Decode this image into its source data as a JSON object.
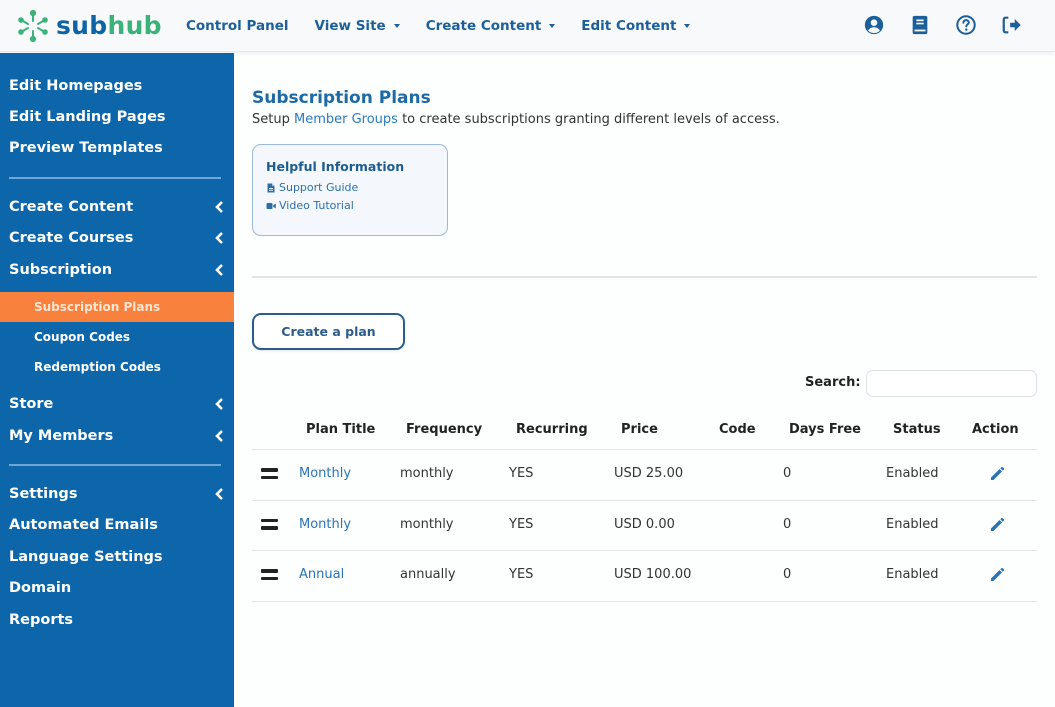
{
  "brand": {
    "name_part1": "sub",
    "name_part2": "hub",
    "colors": {
      "primary": "#0d66aa",
      "accent": "#3bb27a",
      "active": "#f7813d"
    }
  },
  "topnav": {
    "items": [
      {
        "label": "Control Panel",
        "dropdown": false
      },
      {
        "label": "View Site",
        "dropdown": true
      },
      {
        "label": "Create Content",
        "dropdown": true
      },
      {
        "label": "Edit Content",
        "dropdown": true
      }
    ],
    "icons": [
      "user-circle-icon",
      "book-icon",
      "help-circle-icon",
      "sign-out-icon"
    ]
  },
  "sidebar": {
    "group1": [
      "Edit Homepages",
      "Edit Landing Pages",
      "Preview Templates"
    ],
    "group2": [
      {
        "label": "Create Content",
        "expandable": true
      },
      {
        "label": "Create Courses",
        "expandable": true
      },
      {
        "label": "Subscription",
        "expandable": true
      }
    ],
    "subscription_sub": [
      {
        "label": "Subscription Plans",
        "active": true
      },
      {
        "label": "Coupon Codes",
        "active": false
      },
      {
        "label": "Redemption Codes",
        "active": false
      }
    ],
    "group3": [
      {
        "label": "Store",
        "expandable": true
      },
      {
        "label": "My Members",
        "expandable": true
      }
    ],
    "group4": [
      {
        "label": "Settings",
        "expandable": true
      },
      {
        "label": "Automated Emails",
        "expandable": false
      },
      {
        "label": "Language Settings",
        "expandable": false
      },
      {
        "label": "Domain",
        "expandable": false
      },
      {
        "label": "Reports",
        "expandable": false
      }
    ]
  },
  "main": {
    "title": "Subscription Plans",
    "desc_prefix": "Setup ",
    "desc_link": "Member Groups",
    "desc_suffix": " to create subscriptions granting different levels of access.",
    "info_box": {
      "title": "Helpful Information",
      "links": [
        {
          "label": "Support Guide",
          "icon": "file-icon"
        },
        {
          "label": "Video Tutorial",
          "icon": "video-icon"
        }
      ]
    },
    "create_button": "Create a plan",
    "search_label": "Search:",
    "search_value": "",
    "table": {
      "columns": [
        "Plan Title",
        "Frequency",
        "Recurring",
        "Price",
        "Code",
        "Days Free",
        "Status",
        "Action"
      ],
      "rows": [
        {
          "title": "Monthly",
          "frequency": "monthly",
          "recurring": "YES",
          "price": "USD 25.00",
          "code": "",
          "days_free": "0",
          "status": "Enabled"
        },
        {
          "title": "Monthly",
          "frequency": "monthly",
          "recurring": "YES",
          "price": "USD 0.00",
          "code": "",
          "days_free": "0",
          "status": "Enabled"
        },
        {
          "title": "Annual",
          "frequency": "annually",
          "recurring": "YES",
          "price": "USD 100.00",
          "code": "",
          "days_free": "0",
          "status": "Enabled"
        }
      ]
    }
  }
}
